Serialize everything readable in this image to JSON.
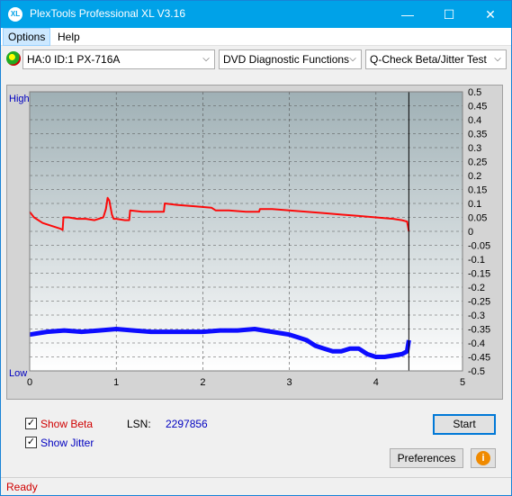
{
  "window": {
    "title": "PlexTools Professional XL V3.16",
    "icon_text": "XL"
  },
  "title_buttons": {
    "minimize": "—",
    "maximize": "☐",
    "close": "✕"
  },
  "menu": [
    {
      "label": "Options"
    },
    {
      "label": "Help"
    }
  ],
  "toolbar": {
    "drive_select": "HA:0 ID:1  PX-716A",
    "function_select": "DVD Diagnostic Functions",
    "test_select": "Q-Check Beta/Jitter Test",
    "dropdown_arrow": "⌵"
  },
  "chart_data": {
    "type": "line",
    "left_axis_labels": {
      "top": "High",
      "bottom": "Low"
    },
    "x_ticks": [
      "0",
      "1",
      "2",
      "3",
      "4",
      "5"
    ],
    "xlim": [
      0,
      5
    ],
    "y_ticks": [
      "0.5",
      "0.45",
      "0.4",
      "0.35",
      "0.3",
      "0.25",
      "0.2",
      "0.15",
      "0.1",
      "0.05",
      "0",
      "-0.05",
      "-0.1",
      "-0.15",
      "-0.2",
      "-0.25",
      "-0.3",
      "-0.35",
      "-0.4",
      "-0.45",
      "-0.5"
    ],
    "ylim": [
      -0.5,
      0.5
    ],
    "grid": true,
    "end_marker_x": 4.38,
    "series": [
      {
        "name": "Beta",
        "color": "#ff0000",
        "x": [
          0,
          0.05,
          0.15,
          0.25,
          0.35,
          0.38,
          0.39,
          0.45,
          0.55,
          0.65,
          0.75,
          0.85,
          0.88,
          0.9,
          0.92,
          0.95,
          0.97,
          1.0,
          1.1,
          1.15,
          1.16,
          1.3,
          1.45,
          1.55,
          1.56,
          1.7,
          1.9,
          2.1,
          2.15,
          2.3,
          2.5,
          2.65,
          2.66,
          2.8,
          3.0,
          3.2,
          3.4,
          3.6,
          3.8,
          4.0,
          4.2,
          4.3,
          4.36,
          4.38
        ],
        "y": [
          0.07,
          0.05,
          0.03,
          0.02,
          0.01,
          0.005,
          0.05,
          0.05,
          0.045,
          0.045,
          0.04,
          0.05,
          0.08,
          0.12,
          0.11,
          0.06,
          0.045,
          0.045,
          0.04,
          0.04,
          0.075,
          0.07,
          0.07,
          0.07,
          0.1,
          0.095,
          0.09,
          0.085,
          0.075,
          0.075,
          0.07,
          0.07,
          0.08,
          0.08,
          0.075,
          0.07,
          0.065,
          0.06,
          0.055,
          0.05,
          0.045,
          0.04,
          0.035,
          0.0
        ]
      },
      {
        "name": "Jitter",
        "color": "#0000ff",
        "x": [
          0,
          0.2,
          0.4,
          0.6,
          0.8,
          1.0,
          1.2,
          1.4,
          1.6,
          1.8,
          2.0,
          2.2,
          2.4,
          2.6,
          2.8,
          3.0,
          3.1,
          3.2,
          3.3,
          3.4,
          3.5,
          3.6,
          3.7,
          3.8,
          3.9,
          4.0,
          4.1,
          4.2,
          4.3,
          4.36,
          4.38
        ],
        "y": [
          -0.37,
          -0.36,
          -0.355,
          -0.36,
          -0.355,
          -0.35,
          -0.355,
          -0.36,
          -0.36,
          -0.36,
          -0.36,
          -0.355,
          -0.355,
          -0.35,
          -0.36,
          -0.37,
          -0.38,
          -0.39,
          -0.41,
          -0.42,
          -0.43,
          -0.43,
          -0.42,
          -0.42,
          -0.44,
          -0.45,
          -0.45,
          -0.445,
          -0.44,
          -0.43,
          -0.39
        ]
      }
    ]
  },
  "controls": {
    "show_beta": {
      "checked": true,
      "label": "Show Beta",
      "mark": "✓"
    },
    "show_jitter": {
      "checked": true,
      "label": "Show Jitter",
      "mark": "✓"
    },
    "lsn_label": "LSN:",
    "lsn_value": "2297856",
    "start_button": "Start",
    "preferences_button": "Preferences",
    "info_icon": "i"
  },
  "status": {
    "text": "Ready"
  },
  "colors": {
    "titlebar": "#00a2e8",
    "beta_label": "#d00000",
    "jitter_label": "#0000c0",
    "lsn_value": "#0000c0",
    "status_text": "#d00000"
  }
}
